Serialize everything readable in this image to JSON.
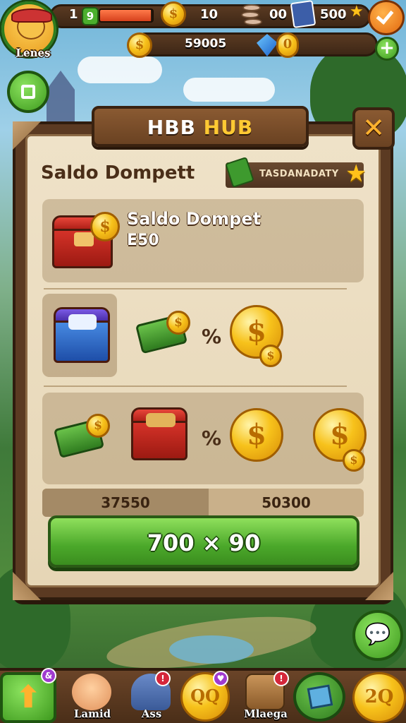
{
  "player": {
    "name": "Lenes",
    "level": "1",
    "level_badge": "9",
    "xp_fraction": 0.97
  },
  "hud": {
    "coins_count": "10",
    "stack_count": "00",
    "cards_count": "500",
    "balance": "59005",
    "gem_count": "0"
  },
  "panel": {
    "title_part1": "HBB",
    "title_part2": "HUB",
    "close_label": "✕",
    "wallet_title": "Saldo Dompett",
    "tag_label": "TASDANADATY",
    "row1_title": "Saldo Dompet",
    "row1_amount": "E50",
    "row2_percent": "%",
    "row3_percent": "%",
    "value_left": "37550",
    "value_right": "50300",
    "cta_label": "700 × 90"
  },
  "nav": {
    "items": [
      {
        "label": "Lamid",
        "badge": "&"
      },
      {
        "label": "Ass",
        "badge": "!"
      },
      {
        "label": "",
        "badge": "♥"
      },
      {
        "label": "Mlaega",
        "badge": "!"
      }
    ],
    "coin_btn_label": "2Q",
    "qq_label": "QQ"
  },
  "colors": {
    "wood": "#5b3a22",
    "parchment": "#efe2c8",
    "accent_green": "#4ba82a",
    "gold": "#f7c21b"
  }
}
